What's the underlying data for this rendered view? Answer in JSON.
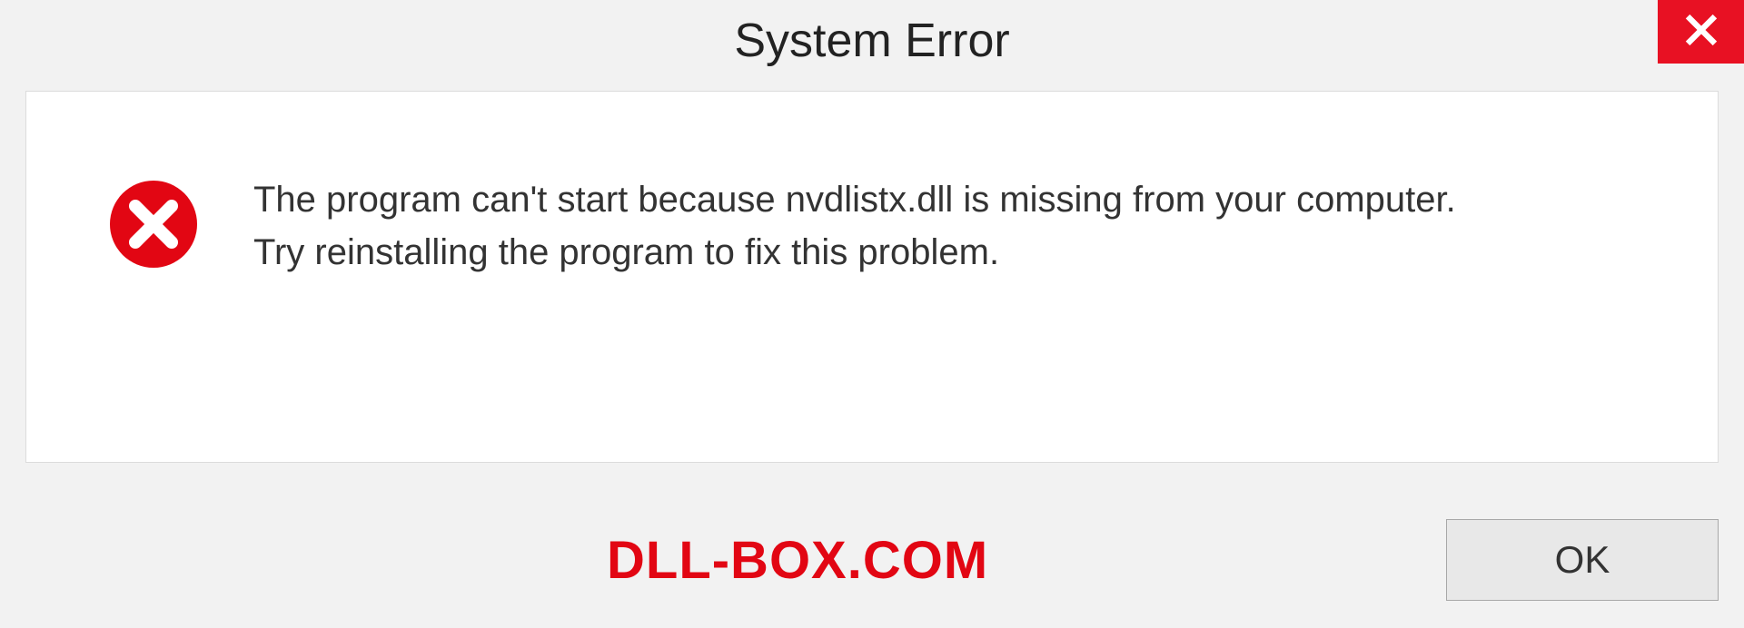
{
  "dialog": {
    "title": "System Error",
    "message_line1": "The program can't start because nvdlistx.dll is missing from your computer.",
    "message_line2": "Try reinstalling the program to fix this problem.",
    "ok_label": "OK"
  },
  "watermark": {
    "text": "DLL-BOX.COM"
  },
  "colors": {
    "close_bg": "#e81123",
    "error_red": "#e20613"
  }
}
